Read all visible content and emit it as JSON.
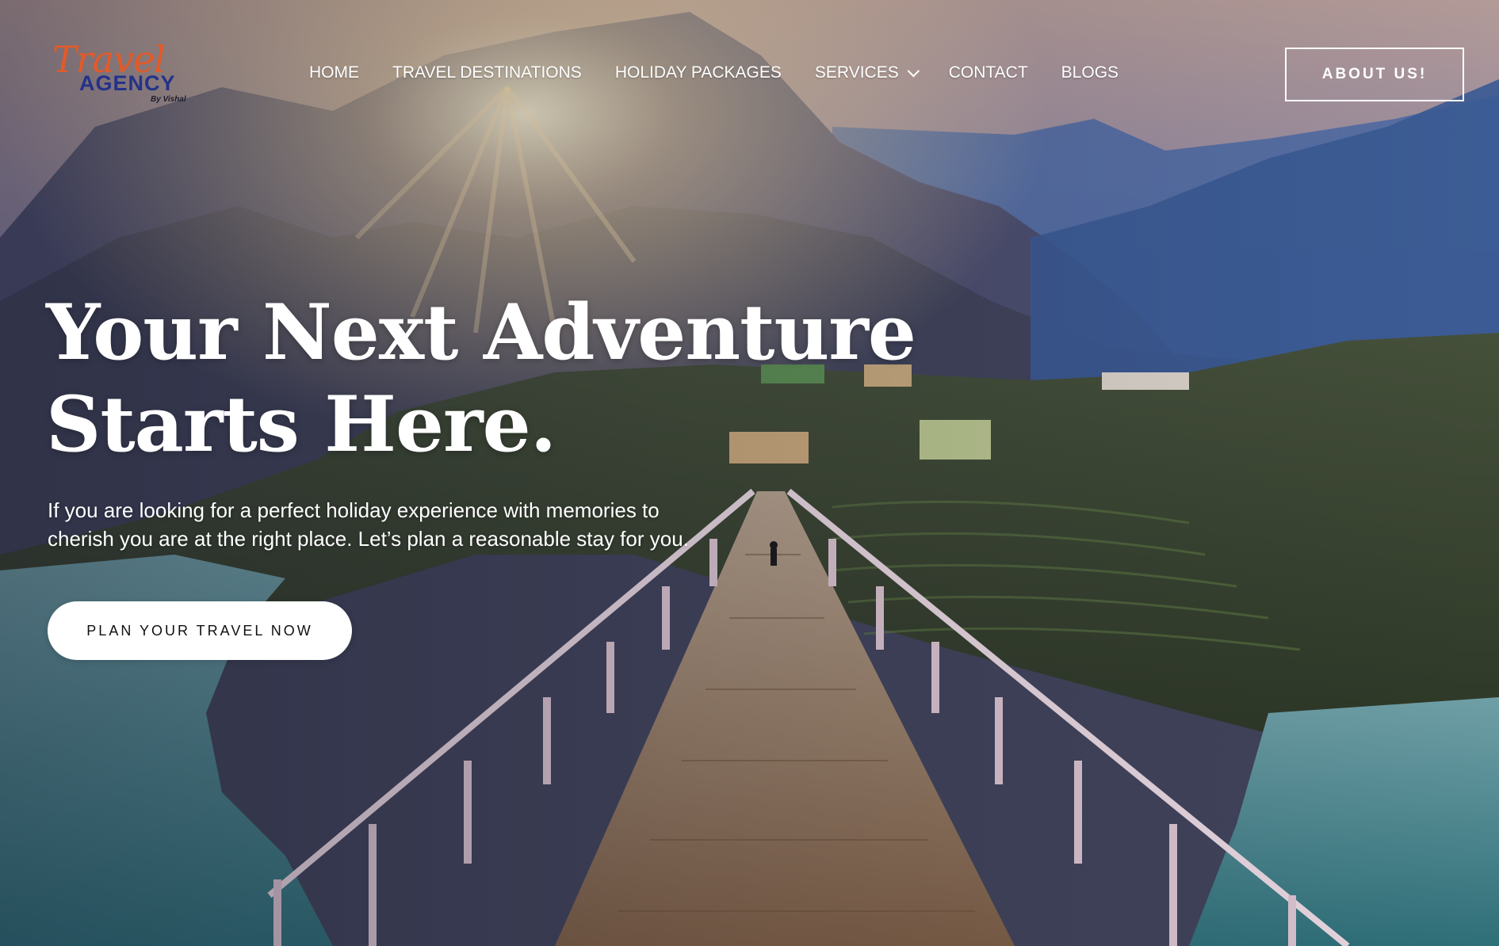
{
  "brand": {
    "script": "Travel",
    "agency": "AGENCY",
    "byline": "By Vishal"
  },
  "nav": {
    "items": [
      {
        "label": "HOME"
      },
      {
        "label": "TRAVEL DESTINATIONS"
      },
      {
        "label": "HOLIDAY PACKAGES"
      },
      {
        "label": "SERVICES",
        "has_dropdown": true
      },
      {
        "label": "CONTACT"
      },
      {
        "label": "BLOGS"
      }
    ],
    "about_label": "ABOUT US!"
  },
  "hero": {
    "title_line1": "Your Next Adventure",
    "title_line2": "Starts Here.",
    "subtitle_line1": "If you are looking for a perfect holiday experience with memories to",
    "subtitle_line2": "cherish you are at the right place. Let’s plan a reasonable stay for you.",
    "cta_label": "PLAN YOUR TRAVEL NOW"
  },
  "colors": {
    "logo_script": "#e35a28",
    "logo_agency": "#24328a",
    "text": "#ffffff",
    "cta_bg": "#ffffff",
    "cta_text": "#111111"
  },
  "icons": {
    "services_dropdown": "chevron-down-icon"
  }
}
